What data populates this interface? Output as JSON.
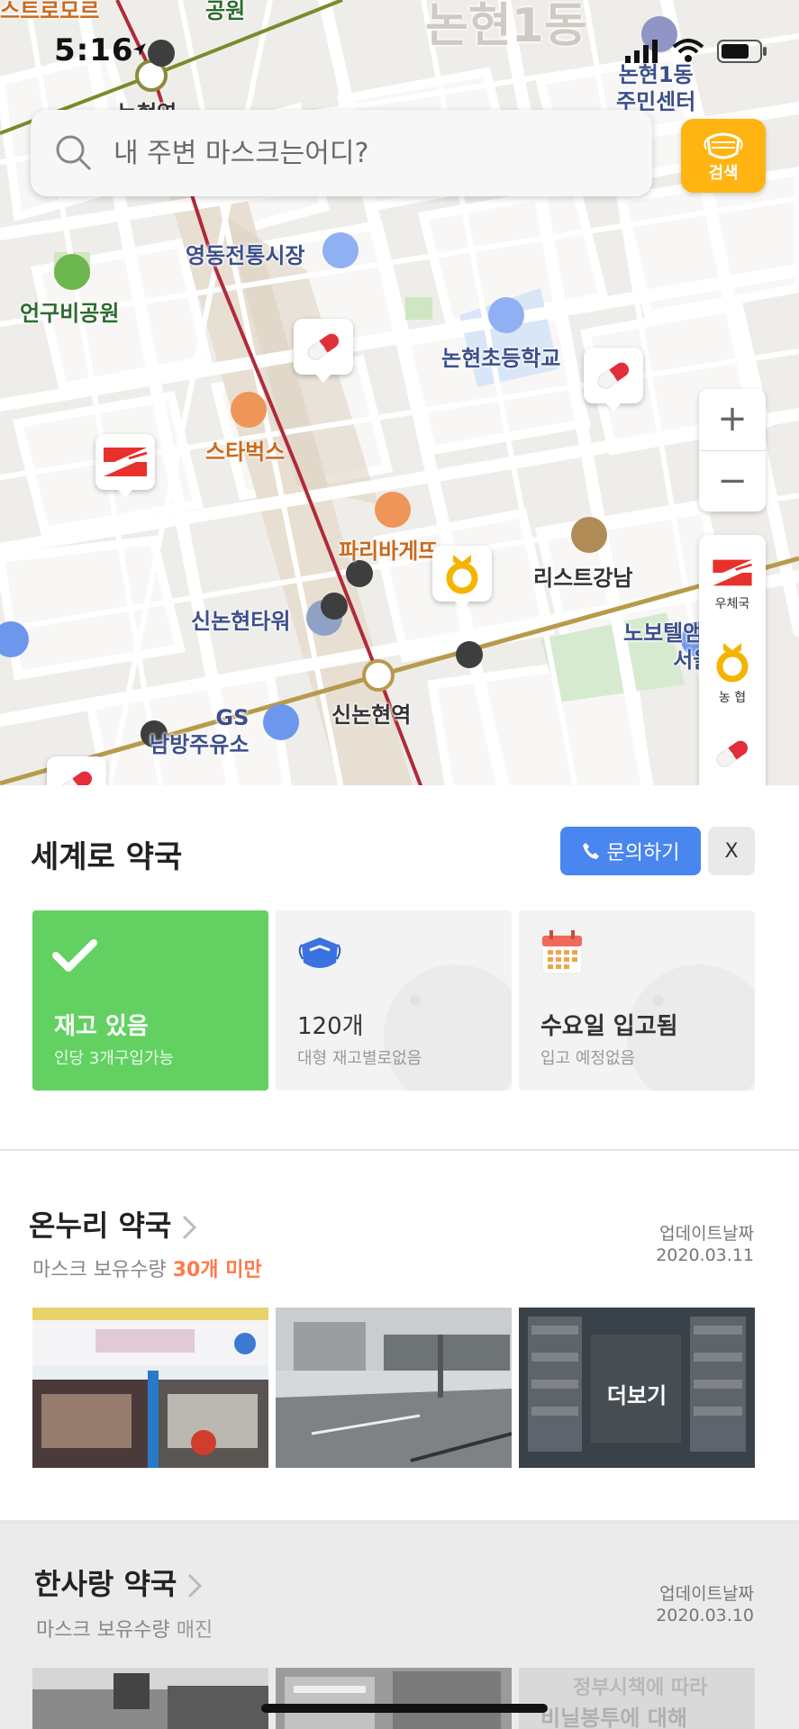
{
  "status_bar": {
    "time": "5:16"
  },
  "map": {
    "labels": {
      "top_left": "스트로모르",
      "park_top": "공원",
      "district": "논현1동",
      "station_top": "논현역",
      "center": "논현1동\n주민센터",
      "market": "영동전통시장",
      "park": "언구비공원",
      "school": "논현초등학교",
      "starbucks": "스타벅스",
      "paris": "파리바게뜨",
      "list": "리스트강남",
      "tower": "신논현타워",
      "novotel": "노보텔앰배서더\n서울",
      "station": "신논현역",
      "gs": "GS\n남방주유소"
    },
    "search_placeholder": "내 주변 마스크는어디?",
    "search_button": "검색",
    "zoom_in": "+",
    "zoom_out": "−",
    "rail": {
      "post": "우체국",
      "nh": "농 협"
    }
  },
  "detail": {
    "title": "세계로 약국",
    "contact_button": "문의하기",
    "close_button": "X",
    "cards": [
      {
        "head": "재고 있음",
        "sub": "인당 3개구입가능"
      },
      {
        "head": "120개",
        "sub": "대형 재고별로없음"
      },
      {
        "head": "수요일 입고됨",
        "sub": "입고 예정없음"
      }
    ]
  },
  "stores": [
    {
      "name": "온누리 약국",
      "sub_prefix": "마스크 보유수량",
      "sub_value": "30개 미만",
      "update_label": "업데이트날짜",
      "update_date": "2020.03.11",
      "more": "더보기",
      "sub_color": "#ff7a4a"
    },
    {
      "name": "한사랑 약국",
      "sub_prefix": "마스크 보유수량",
      "sub_value": "매진",
      "update_label": "업데이트날짜",
      "update_date": "2020.03.10",
      "sub_color": "#999999"
    }
  ],
  "photo_texts": {
    "bannerA": "정부시책에 따라",
    "bannerB": "비닐봉투에 대해"
  }
}
